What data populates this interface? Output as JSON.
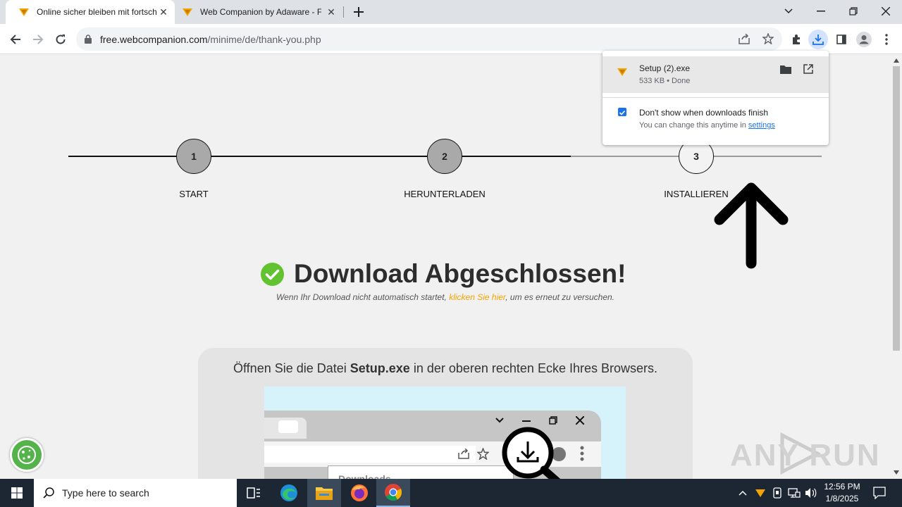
{
  "browser": {
    "tabs": [
      {
        "title": "Online sicher bleiben mit fortsch",
        "active": true
      },
      {
        "title": "Web Companion by Adaware - F",
        "active": false
      }
    ],
    "url_host": "free.webcompanion.com",
    "url_path": "/minime/de/thank-you.php"
  },
  "downloads": {
    "file_name": "Setup (2).exe",
    "file_status": "533 KB • Done",
    "checkbox_label": "Don't show when downloads finish",
    "hint_prefix": "You can change this anytime in ",
    "settings_link": "settings",
    "checked": true
  },
  "steps": [
    {
      "number": "1",
      "label": "START"
    },
    {
      "number": "2",
      "label": "HERUNTERLADEN"
    },
    {
      "number": "3",
      "label": "INSTALLIEREN"
    }
  ],
  "main": {
    "heading": "Download Abgeschlossen!",
    "sub_prefix": "Wenn Ihr Download nicht automatisch startet, ",
    "sub_link": "klicken Sie hier",
    "sub_suffix": ", um es erneut zu versuchen.",
    "card_prefix": "Öffnen Sie die Datei ",
    "card_file": "Setup.exe",
    "card_suffix": " in der oberen rechten Ecke Ihres Browsers.",
    "illustration_label": "Downloads"
  },
  "watermark": "ANY RUN",
  "taskbar": {
    "search_placeholder": "Type here to search",
    "time": "12:56 PM",
    "date": "1/8/2025"
  },
  "colors": {
    "accent_orange": "#f5a300",
    "check_green": "#62c230",
    "chrome_blue": "#1a73e8"
  }
}
